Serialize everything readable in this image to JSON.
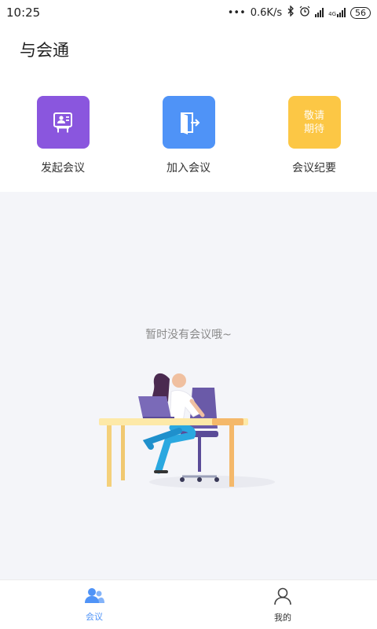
{
  "status": {
    "time": "10:25",
    "speed": "0.6K/s",
    "network_tag": "4G",
    "battery": "56"
  },
  "app": {
    "title": "与会通"
  },
  "actions": [
    {
      "label": "发起会议",
      "icon": "presentation-icon",
      "color": "#8a56de"
    },
    {
      "label": "加入会议",
      "icon": "door-enter-icon",
      "color": "#4f93f7"
    },
    {
      "label": "会议纪要",
      "icon": "coming-soon-icon",
      "color": "#fcc745",
      "tile_text": "敬请期待"
    }
  ],
  "empty": {
    "message": "暂时没有会议哦~"
  },
  "tabs": [
    {
      "label": "会议",
      "icon": "meeting-users-icon",
      "active": true,
      "color": "#4f93f7"
    },
    {
      "label": "我的",
      "icon": "profile-icon",
      "active": false
    }
  ]
}
